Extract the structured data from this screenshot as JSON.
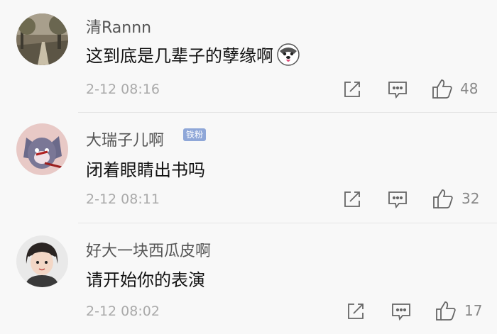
{
  "comments": [
    {
      "username": "清Rannn",
      "badge": "",
      "content": "这到底是几辈子的孽缘啊",
      "emoji_icon": "husky-emoji-icon",
      "time": "2-12 08:16",
      "likes": "48"
    },
    {
      "username": "大瑞子儿啊",
      "badge": "铁粉",
      "content": "闭着眼睛出书吗",
      "emoji_icon": "",
      "time": "2-12 08:11",
      "likes": "32"
    },
    {
      "username": "好大一块西瓜皮啊",
      "badge": "",
      "content": "请开始你的表演",
      "emoji_icon": "",
      "time": "2-12 08:02",
      "likes": "17"
    }
  ],
  "icons": {
    "share": "share-icon",
    "reply": "comment-icon",
    "like": "thumbs-up-icon"
  },
  "colors": {
    "background": "#f8f8f8",
    "badge": "#8fa7d8",
    "meta_text": "#aaaaaa"
  }
}
